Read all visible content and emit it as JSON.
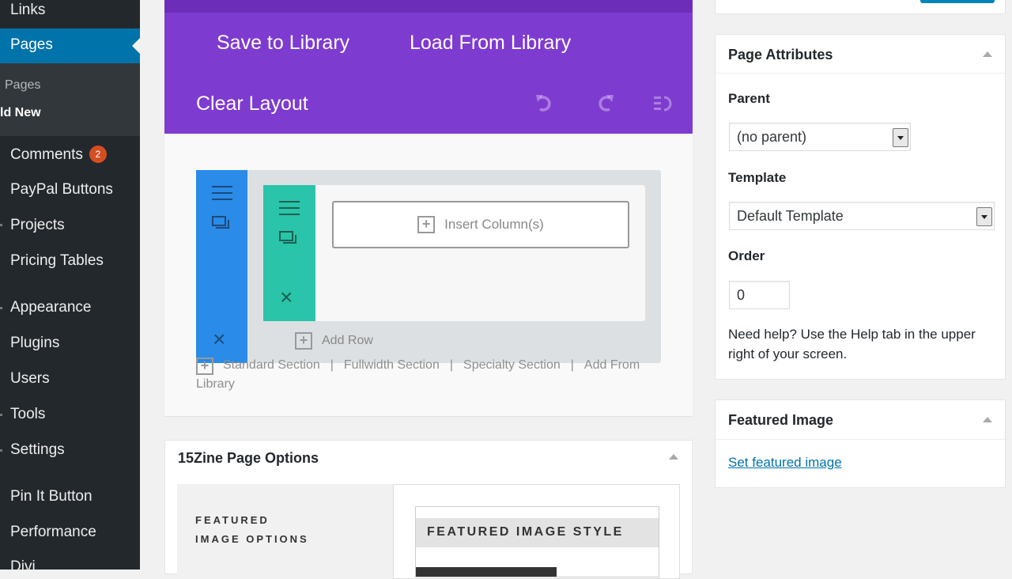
{
  "sidebar": {
    "items_top": [
      {
        "label": "Links"
      }
    ],
    "active": {
      "label": "Pages"
    },
    "submenu": [
      {
        "label": "Pages"
      },
      {
        "label": "ld New"
      }
    ],
    "items": [
      {
        "label": "Comments",
        "badge": "2"
      },
      {
        "label": "PayPal Buttons"
      },
      {
        "label": "Projects"
      },
      {
        "label": "Pricing Tables"
      },
      {
        "label": "Appearance"
      },
      {
        "label": "Plugins"
      },
      {
        "label": "Users"
      },
      {
        "label": "Tools"
      },
      {
        "label": "Settings"
      },
      {
        "label": "Pin It Button"
      },
      {
        "label": "Performance"
      },
      {
        "label": "Divi"
      }
    ]
  },
  "builder": {
    "save_label": "Save to Library",
    "load_label": "Load From Library",
    "clear_label": "Clear Layout",
    "undo_icon": "undo-icon",
    "redo_icon": "redo-icon",
    "history_icon": "history-icon",
    "insert_column_label": "Insert Column(s)",
    "add_row_label": "Add Row",
    "section_links": {
      "standard": "Standard Section",
      "fullwidth": "Fullwidth Section",
      "specialty": "Specialty Section",
      "library": "Add From Library",
      "separator": "|"
    },
    "colors": {
      "purple": "#7e3bd0",
      "section_blue": "#2a8be8",
      "row_green": "#29c4a9"
    }
  },
  "zine": {
    "title": "15Zine Page Options",
    "featured_options_line1": "FEATURED",
    "featured_options_line2": "IMAGE OPTIONS",
    "featured_style_label": "FEATURED IMAGE STYLE"
  },
  "page_attributes": {
    "title": "Page Attributes",
    "parent_label": "Parent",
    "parent_value": "(no parent)",
    "template_label": "Template",
    "template_value": "Default Template",
    "order_label": "Order",
    "order_value": "0",
    "help_text": "Need help? Use the Help tab in the upper right of your screen."
  },
  "featured_image": {
    "title": "Featured Image",
    "link_label": "Set featured image"
  }
}
